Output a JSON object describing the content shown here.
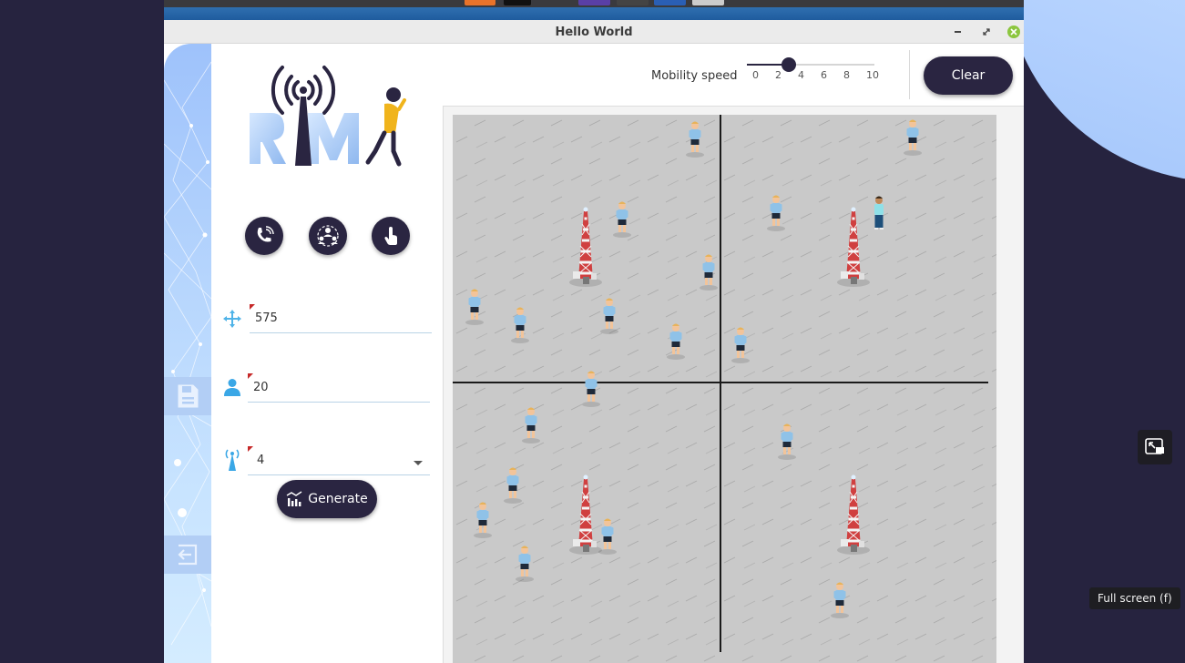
{
  "window": {
    "title": "Hello World"
  },
  "tooltip": "Full screen (f)",
  "tools": [
    {
      "name": "call-tool-button",
      "icon": "phone-icon"
    },
    {
      "name": "group-tool-button",
      "icon": "users-network-icon"
    },
    {
      "name": "touch-tool-button",
      "icon": "hand-pointer-icon"
    }
  ],
  "form": {
    "area": {
      "value": "575",
      "icon": "move-arrows-icon"
    },
    "users": {
      "value": "20",
      "icon": "user-icon"
    },
    "antennas": {
      "value": "4",
      "icon": "antenna-icon"
    }
  },
  "generate_label": "Generate",
  "clear_label": "Clear",
  "mobility": {
    "label": "Mobility speed",
    "value": 3.3,
    "min": 0,
    "max": 10,
    "ticks": [
      "0",
      "2",
      "4",
      "6",
      "8",
      "10"
    ]
  },
  "colors": {
    "accent": "#2a2541",
    "map_background": "#c9c9c9",
    "field_underline": "#b9d3e6"
  }
}
